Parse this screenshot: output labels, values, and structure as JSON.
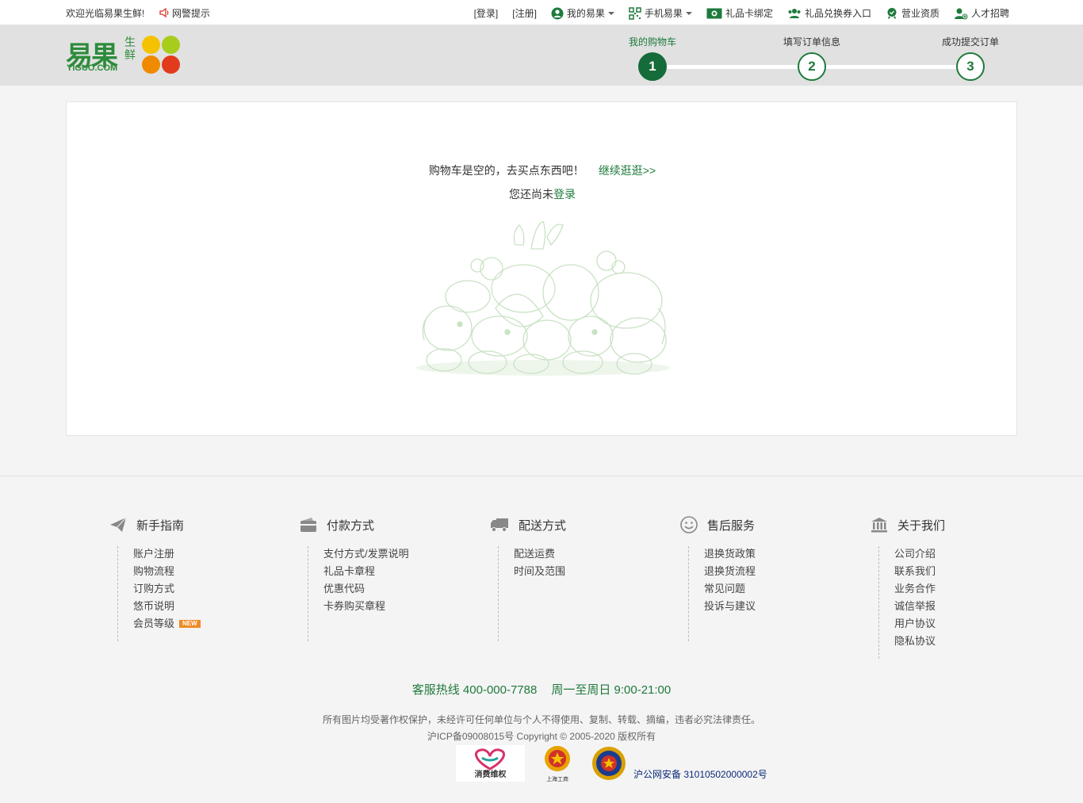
{
  "topbar": {
    "welcome": "欢迎光临易果生鲜!",
    "alert": "网警提示",
    "login": "[登录]",
    "register": "[注册]",
    "my_yiguo": "我的易果",
    "mobile_yiguo": "手机易果",
    "gift_card_bind": "礼品卡绑定",
    "gift_coupon": "礼品兑换券入口",
    "license": "营业资质",
    "jobs": "人才招聘"
  },
  "header": {
    "logo_cn": "易果",
    "logo_fresh": "生鲜",
    "logo_en": "YIGUO.COM",
    "steps": [
      {
        "label": "我的购物车",
        "num": "1"
      },
      {
        "label": "填写订单信息",
        "num": "2"
      },
      {
        "label": "成功提交订单",
        "num": "3"
      }
    ]
  },
  "cart": {
    "empty_text": "购物车是空的，去买点东西吧！",
    "continue_link": "继续逛逛>>",
    "not_logged_prefix": "您还尚未",
    "login_link": "登录"
  },
  "footer": {
    "columns": [
      {
        "title": "新手指南",
        "icon": "paper-plane-icon",
        "items": [
          "账户注册",
          "购物流程",
          "订购方式",
          "悠币说明",
          "会员等级"
        ]
      },
      {
        "title": "付款方式",
        "icon": "wallet-icon",
        "items": [
          "支付方式/发票说明",
          "礼品卡章程",
          "优惠代码",
          "卡券购买章程"
        ]
      },
      {
        "title": "配送方式",
        "icon": "truck-icon",
        "items": [
          "配送运费",
          "时间及范围"
        ]
      },
      {
        "title": "售后服务",
        "icon": "smiley-icon",
        "items": [
          "退换货政策",
          "退换货流程",
          "常见问题",
          "投诉与建议"
        ]
      },
      {
        "title": "关于我们",
        "icon": "bank-icon",
        "items": [
          "公司介绍",
          "联系我们",
          "业务合作",
          "诚信举报",
          "用户协议",
          "隐私协议"
        ]
      }
    ],
    "new_badge": "NEW",
    "hotline": "客服热线 400-000-7788",
    "hours": "周一至周日 9:00-21:00",
    "copyright": "所有图片均受著作权保护，未经许可任何单位与个人不得使用、复制、转载、摘编，违者必究法律责任。",
    "icp": "沪ICP备09008015号 Copyright © 2005-2020 版权所有",
    "consumer_badge": "消费维权",
    "aic_badge": "上海工商",
    "police_record": "沪公网安备 31010502000002号"
  },
  "colors": {
    "brand_green": "#1f7a3c",
    "active_step": "#156b3a",
    "header_bg": "#e1e1e1",
    "page_bg": "#f4f4f4"
  }
}
